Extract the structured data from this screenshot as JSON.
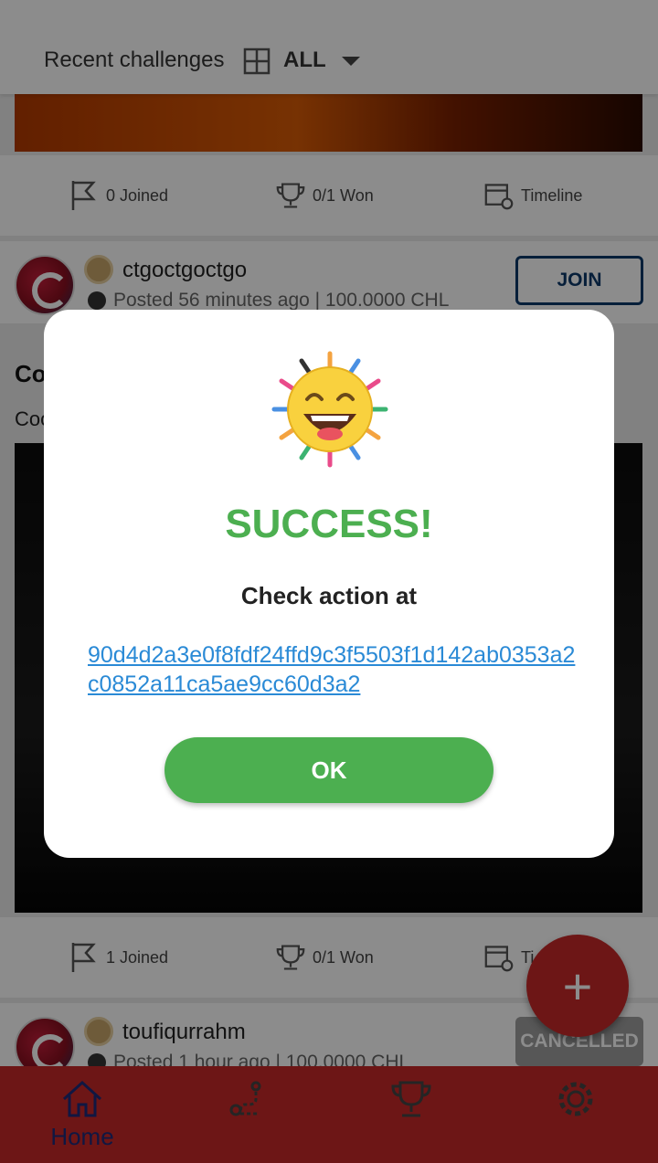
{
  "header": {
    "title": "Recent challenges",
    "filter_label": "ALL"
  },
  "card1": {
    "stats": {
      "joined": "0 Joined",
      "won": "0/1 Won",
      "timeline": "Timeline"
    }
  },
  "card2": {
    "username": "ctgoctgoctgo",
    "posted": "Posted 56 minutes ago | 100.0000 CHL",
    "join_label": "JOIN",
    "title_partial": "Co",
    "desc_partial": "Coo",
    "stats": {
      "joined": "1 Joined",
      "won": "0/1 Won",
      "timeline": "Ti"
    }
  },
  "card3": {
    "username": "toufiqurrahm",
    "posted": "Posted 1 hour ago | 100.0000 CHL",
    "status_label": "CANCELLED"
  },
  "fab": {
    "label": "+"
  },
  "bottom_nav": {
    "home_label": "Home",
    "active_color": "#1e2a78"
  },
  "modal": {
    "title": "SUCCESS!",
    "message": "Check action at",
    "tx_link": "90d4d2a3e0f8fdf24ffd9c3f5503f1d142ab0353a2c0852a11ca5ae9cc60d3a2",
    "ok_label": "OK"
  },
  "colors": {
    "primary": "#c62828",
    "success": "#4caf50",
    "link": "#2a8ad6",
    "join_border": "#0e3a6b"
  }
}
